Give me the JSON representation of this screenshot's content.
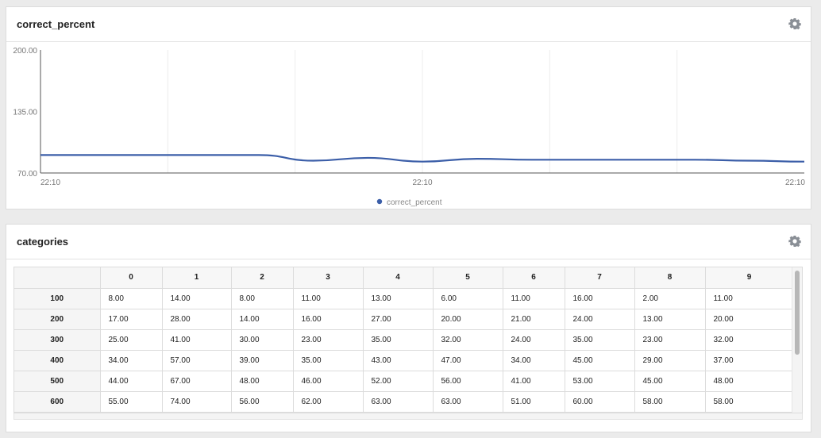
{
  "panels": [
    {
      "title": "correct_percent",
      "settings_icon": "gear-icon"
    },
    {
      "title": "categories",
      "settings_icon": "gear-icon"
    }
  ],
  "colors": {
    "series": "#3b5ea8",
    "grid": "#ececec"
  },
  "chart_data": {
    "type": "line",
    "ytick_labels": [
      "200.00",
      "135.00",
      "70.00"
    ],
    "ylim": [
      70,
      200
    ],
    "yticks": [
      200,
      135,
      70
    ],
    "xtick_labels": [
      "22:10",
      "22:10",
      "22:10"
    ],
    "grid": true,
    "legend": "bottom-center",
    "series": [
      {
        "name": "correct_percent",
        "values": [
          89,
          89,
          89,
          89,
          89,
          83,
          86,
          82,
          85,
          84,
          84,
          84,
          84,
          83,
          82
        ]
      }
    ]
  },
  "table": {
    "columns": [
      "0",
      "1",
      "2",
      "3",
      "4",
      "5",
      "6",
      "7",
      "8",
      "9"
    ],
    "rows": [
      {
        "label": "100",
        "cells": [
          "8.00",
          "14.00",
          "8.00",
          "11.00",
          "13.00",
          "6.00",
          "11.00",
          "16.00",
          "2.00",
          "11.00"
        ]
      },
      {
        "label": "200",
        "cells": [
          "17.00",
          "28.00",
          "14.00",
          "16.00",
          "27.00",
          "20.00",
          "21.00",
          "24.00",
          "13.00",
          "20.00"
        ]
      },
      {
        "label": "300",
        "cells": [
          "25.00",
          "41.00",
          "30.00",
          "23.00",
          "35.00",
          "32.00",
          "24.00",
          "35.00",
          "23.00",
          "32.00"
        ]
      },
      {
        "label": "400",
        "cells": [
          "34.00",
          "57.00",
          "39.00",
          "35.00",
          "43.00",
          "47.00",
          "34.00",
          "45.00",
          "29.00",
          "37.00"
        ]
      },
      {
        "label": "500",
        "cells": [
          "44.00",
          "67.00",
          "48.00",
          "46.00",
          "52.00",
          "56.00",
          "41.00",
          "53.00",
          "45.00",
          "48.00"
        ]
      },
      {
        "label": "600",
        "cells": [
          "55.00",
          "74.00",
          "56.00",
          "62.00",
          "63.00",
          "63.00",
          "51.00",
          "60.00",
          "58.00",
          "58.00"
        ]
      }
    ]
  }
}
